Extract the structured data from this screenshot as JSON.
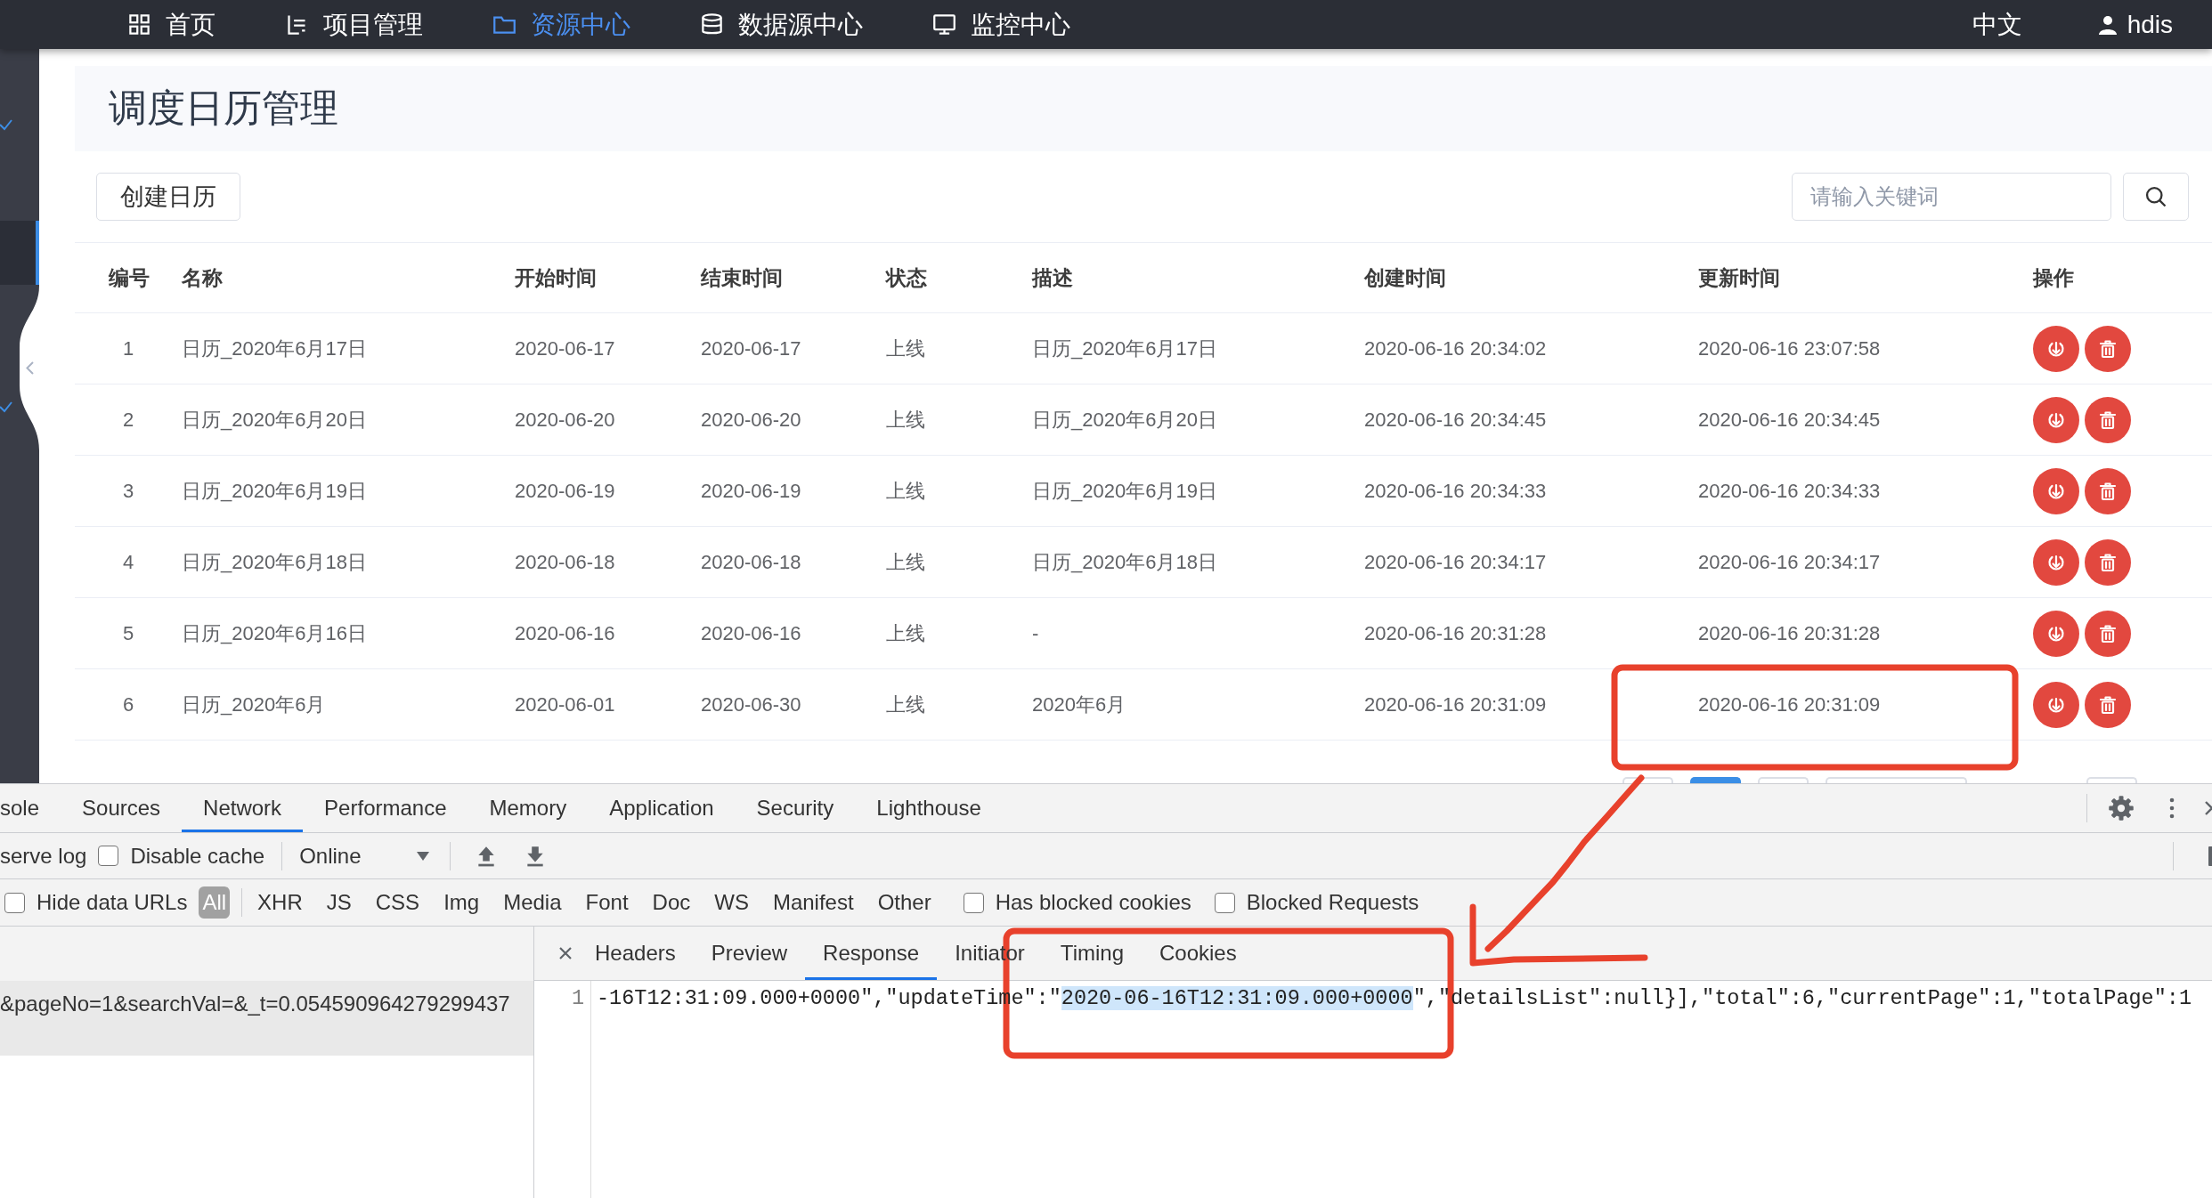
{
  "top_nav": {
    "items": [
      {
        "label": "首页",
        "selected": false
      },
      {
        "label": "项目管理",
        "selected": false
      },
      {
        "label": "资源中心",
        "selected": true
      },
      {
        "label": "数据源中心",
        "selected": false
      },
      {
        "label": "监控中心",
        "selected": false
      }
    ],
    "language": "中文",
    "user": "hdis"
  },
  "sidebar": {
    "items": [
      {
        "kind": "check",
        "selected": false
      },
      {
        "kind": "plain",
        "selected": true
      },
      {
        "kind": "check",
        "selected": false
      }
    ]
  },
  "page": {
    "title": "调度日历管理",
    "create_button": "创建日历",
    "search": {
      "placeholder": "请输入关键词"
    }
  },
  "table": {
    "columns": [
      "编号",
      "名称",
      "开始时间",
      "结束时间",
      "状态",
      "描述",
      "创建时间",
      "更新时间",
      "操作"
    ],
    "rows": [
      {
        "cells": [
          "1",
          "日历_2020年6月17日",
          "2020-06-17",
          "2020-06-17",
          "上线",
          "日历_2020年6月17日",
          "2020-06-16 20:34:02",
          "2020-06-16 23:07:58"
        ]
      },
      {
        "cells": [
          "2",
          "日历_2020年6月20日",
          "2020-06-20",
          "2020-06-20",
          "上线",
          "日历_2020年6月20日",
          "2020-06-16 20:34:45",
          "2020-06-16 20:34:45"
        ]
      },
      {
        "cells": [
          "3",
          "日历_2020年6月19日",
          "2020-06-19",
          "2020-06-19",
          "上线",
          "日历_2020年6月19日",
          "2020-06-16 20:34:33",
          "2020-06-16 20:34:33"
        ]
      },
      {
        "cells": [
          "4",
          "日历_2020年6月18日",
          "2020-06-18",
          "2020-06-18",
          "上线",
          "日历_2020年6月18日",
          "2020-06-16 20:34:17",
          "2020-06-16 20:34:17"
        ]
      },
      {
        "cells": [
          "5",
          "日历_2020年6月16日",
          "2020-06-16",
          "2020-06-16",
          "上线",
          "-",
          "2020-06-16 20:31:28",
          "2020-06-16 20:31:28"
        ]
      },
      {
        "cells": [
          "6",
          "日历_2020年6月",
          "2020-06-01",
          "2020-06-30",
          "上线",
          "2020年6月",
          "2020-06-16 20:31:09",
          "2020-06-16 20:31:09"
        ]
      }
    ]
  },
  "pager": [
    {
      "kind": "button",
      "selected": false
    },
    {
      "kind": "button",
      "selected": true
    },
    {
      "kind": "button",
      "selected": false
    },
    {
      "kind": "select",
      "selected": false
    },
    {
      "kind": "button",
      "selected": false
    }
  ],
  "devtools": {
    "tabs": [
      {
        "label": "sole",
        "selected": false
      },
      {
        "label": "Sources",
        "selected": false
      },
      {
        "label": "Network",
        "selected": true
      },
      {
        "label": "Performance",
        "selected": false
      },
      {
        "label": "Memory",
        "selected": false
      },
      {
        "label": "Application",
        "selected": false
      },
      {
        "label": "Security",
        "selected": false
      },
      {
        "label": "Lighthouse",
        "selected": false
      }
    ],
    "toolbar": {
      "preserve_log": "serve log",
      "disable_cache": {
        "label": "Disable cache",
        "checked": false
      },
      "throttling": "Online"
    },
    "filter": {
      "hide_data_urls": {
        "label": "Hide data URLs",
        "checked": false
      },
      "types": [
        {
          "label": "All",
          "selected": true
        },
        {
          "label": "XHR",
          "selected": false
        },
        {
          "label": "JS",
          "selected": false
        },
        {
          "label": "CSS",
          "selected": false
        },
        {
          "label": "Img",
          "selected": false
        },
        {
          "label": "Media",
          "selected": false
        },
        {
          "label": "Font",
          "selected": false
        },
        {
          "label": "Doc",
          "selected": false
        },
        {
          "label": "WS",
          "selected": false
        },
        {
          "label": "Manifest",
          "selected": false
        },
        {
          "label": "Other",
          "selected": false
        }
      ],
      "has_blocked_cookies": {
        "label": "Has blocked cookies",
        "checked": false
      },
      "blocked_requests": {
        "label": "Blocked Requests",
        "checked": false
      }
    },
    "requests": [
      {
        "name": "&pageNo=1&searchVal=&_t=0.054590964279299437",
        "selected": true
      }
    ],
    "detail_tabs": [
      {
        "label": "Headers",
        "selected": false
      },
      {
        "label": "Preview",
        "selected": false
      },
      {
        "label": "Response",
        "selected": true
      },
      {
        "label": "Initiator",
        "selected": false
      },
      {
        "label": "Timing",
        "selected": false
      },
      {
        "label": "Cookies",
        "selected": false
      }
    ],
    "response": {
      "line_number": "1",
      "segments": [
        {
          "text": "-16T12:31:09.000+0000\",\"updateTime\":\"",
          "selected": false
        },
        {
          "text": "2020-06-16T12:31:09.000+0000",
          "selected": true
        },
        {
          "text": "\",\"detailsList\":null}],\"total\":6,\"currentPage\":1,\"totalPage\":1",
          "selected": false
        }
      ]
    }
  },
  "annotations": [
    {
      "kind": "box"
    },
    {
      "kind": "box"
    },
    {
      "kind": "arrow"
    }
  ]
}
